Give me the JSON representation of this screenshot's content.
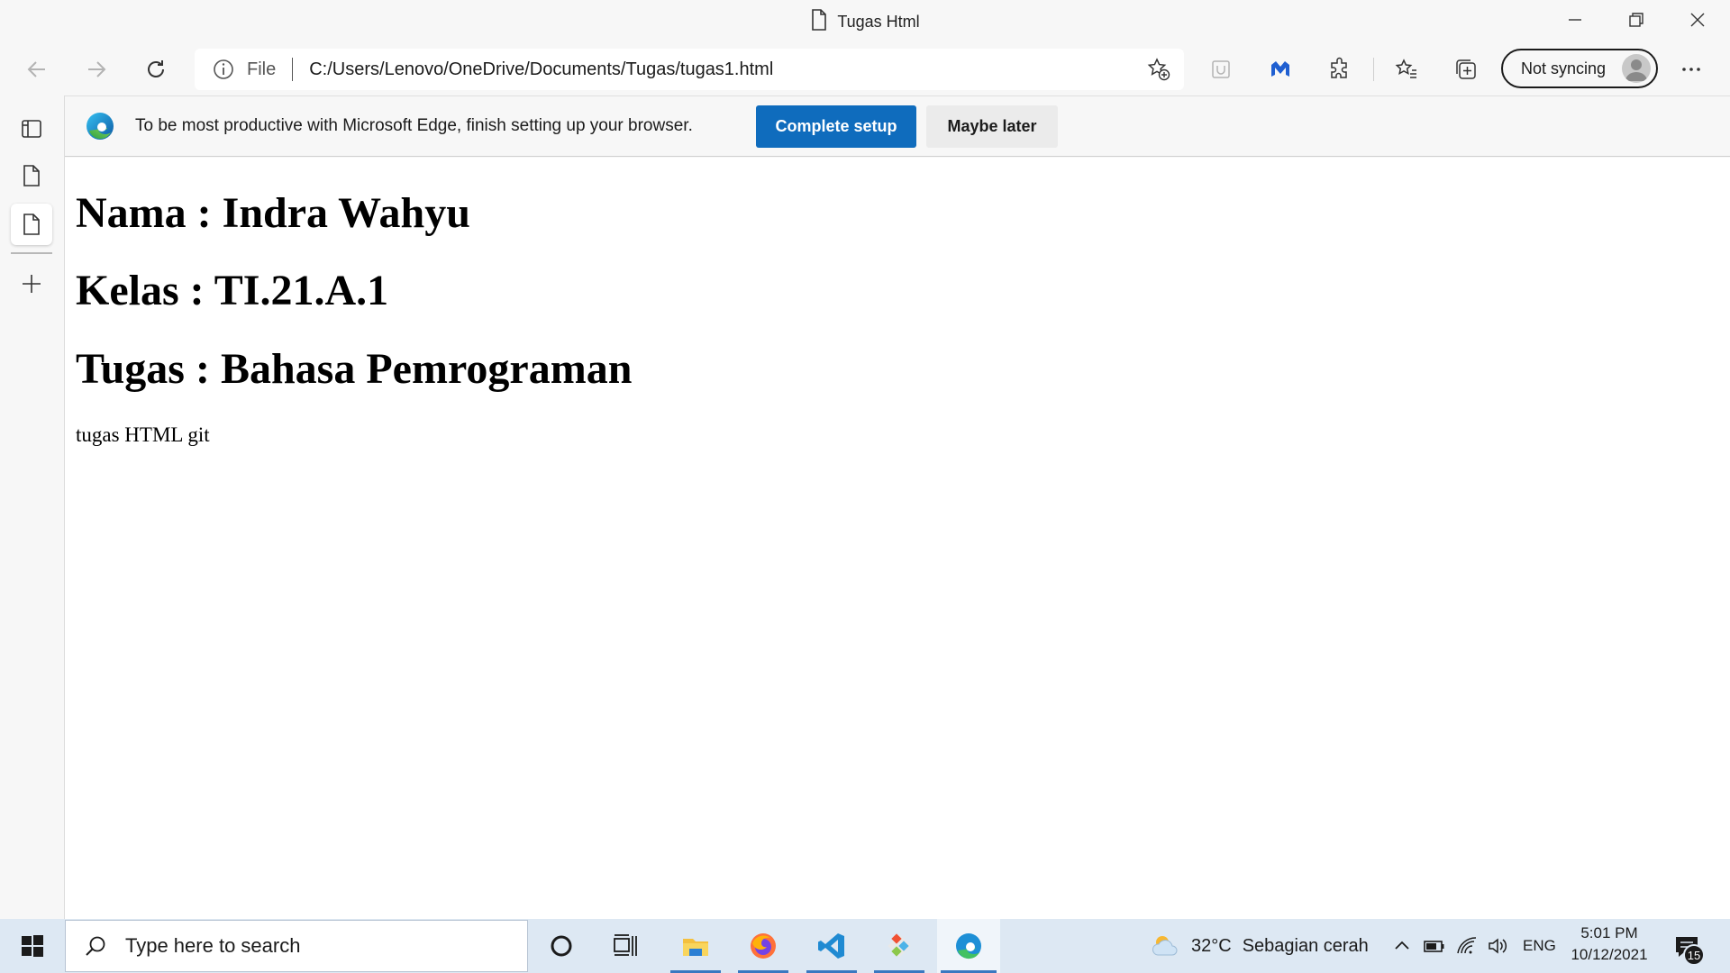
{
  "window": {
    "title": "Tugas Html"
  },
  "toolbar": {
    "file_label": "File",
    "url": "C:/Users/Lenovo/OneDrive/Documents/Tugas/tugas1.html",
    "sync_label": "Not syncing"
  },
  "infobar": {
    "message": "To be most productive with Microsoft Edge, finish setting up your browser.",
    "primary_label": "Complete setup",
    "secondary_label": "Maybe later"
  },
  "page": {
    "heading_name": "Nama : Indra Wahyu",
    "heading_class": "Kelas : TI.21.A.1",
    "heading_task": "Tugas : Bahasa Pemrograman",
    "paragraph": "tugas HTML git"
  },
  "taskbar": {
    "search_placeholder": "Type here to search",
    "weather_temp": "32°C",
    "weather_desc": "Sebagian cerah",
    "language": "ENG",
    "time": "5:01 PM",
    "date": "10/12/2021",
    "notification_count": "15"
  },
  "colors": {
    "accent": "#0f6cbd",
    "taskbar_bg": "#dde8f3",
    "chrome_bg": "#f7f7f7"
  },
  "icons": [
    "file-icon",
    "minimize-icon",
    "restore-icon",
    "close-icon",
    "back-icon",
    "forward-icon",
    "refresh-icon",
    "info-icon",
    "add-favorite-icon",
    "extension-icon",
    "puzzle-icon",
    "favorites-icon",
    "collections-icon",
    "more-icon",
    "tab-actions-icon",
    "edge-logo-icon",
    "windows-start-icon",
    "search-icon",
    "cortana-icon",
    "task-view-icon",
    "file-explorer-icon",
    "firefox-icon",
    "vscode-icon",
    "git-icon",
    "edge-icon",
    "weather-icon",
    "chevron-up-icon",
    "battery-icon",
    "wifi-icon",
    "volume-icon",
    "notification-icon"
  ]
}
